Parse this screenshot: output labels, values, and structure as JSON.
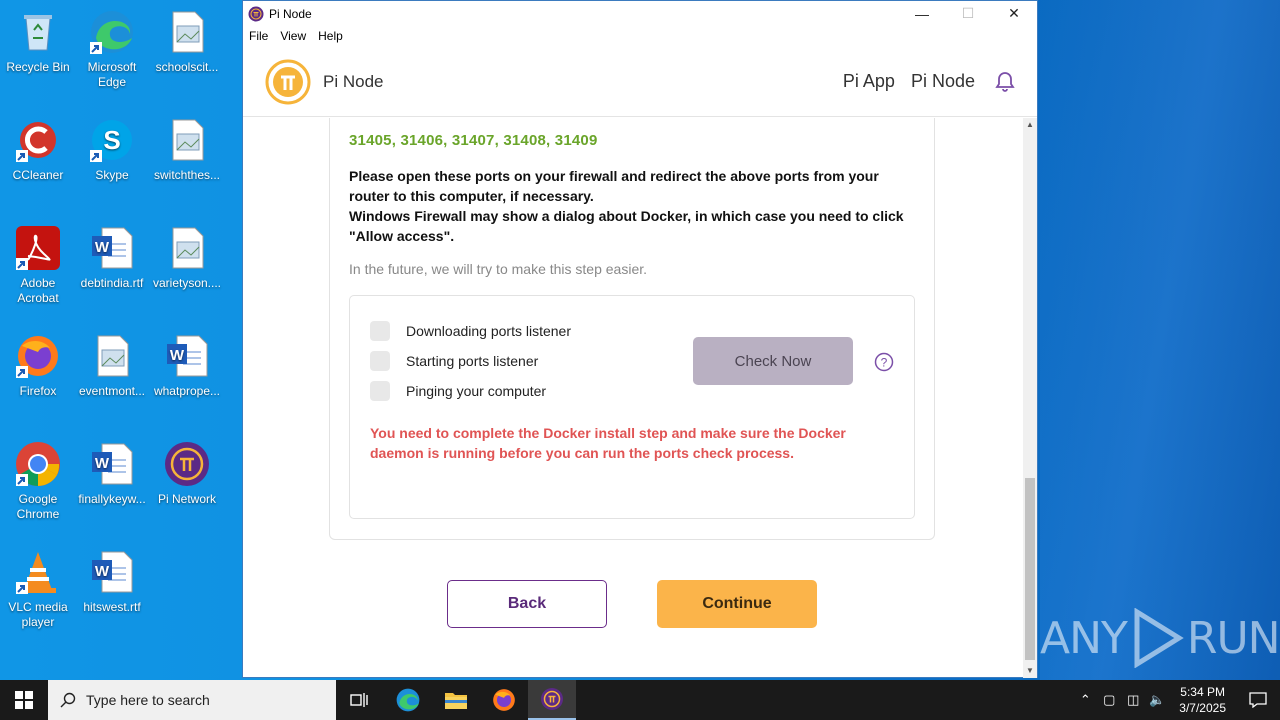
{
  "desktop": {
    "icons": [
      {
        "label": "Recycle Bin"
      },
      {
        "label": "Microsoft Edge"
      },
      {
        "label": "schoolscit..."
      },
      {
        "label": "CCleaner"
      },
      {
        "label": "Skype"
      },
      {
        "label": "switchthes..."
      },
      {
        "label": "Adobe Acrobat"
      },
      {
        "label": "debtindia.rtf"
      },
      {
        "label": "varietyson...."
      },
      {
        "label": "Firefox"
      },
      {
        "label": "eventmont..."
      },
      {
        "label": "whatprope..."
      },
      {
        "label": "Google Chrome"
      },
      {
        "label": "finallykeyw..."
      },
      {
        "label": "Pi Network"
      },
      {
        "label": "VLC media player"
      },
      {
        "label": "hitswest.rtf"
      }
    ]
  },
  "window": {
    "title": "Pi Node",
    "menu": [
      "File",
      "View",
      "Help"
    ]
  },
  "app": {
    "brand": "Pi Node",
    "nav": [
      "Pi App",
      "Pi Node"
    ]
  },
  "content": {
    "ports": "31405, 31406, 31407, 31408, 31409",
    "instructions_1": "Please open these ports on your firewall and redirect the above ports from your router to this computer, if necessary.",
    "instructions_2": "Windows Firewall may show a dialog about Docker, in which case you need to click \"Allow access\".",
    "future_note": "In the future, we will try to make this step easier.",
    "steps": [
      "Downloading ports listener",
      "Starting ports listener",
      "Pinging your computer"
    ],
    "check_button": "Check Now",
    "error": "You need to complete the Docker install step and make sure the Docker daemon is running before you can run the ports check process.",
    "back_button": "Back",
    "continue_button": "Continue"
  },
  "watermark": {
    "left": "ANY",
    "right": "RUN"
  },
  "taskbar": {
    "search_placeholder": "Type here to search",
    "time": "5:34 PM",
    "date": "3/7/2025"
  },
  "colors": {
    "ports_green": "#6aa52a",
    "error_red": "#e05454",
    "continue_orange": "#fbb44a",
    "back_border_purple": "#6b2d8a"
  }
}
